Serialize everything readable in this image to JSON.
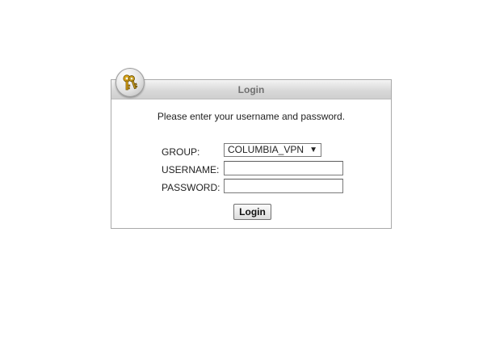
{
  "panel": {
    "title": "Login",
    "intro": "Please enter your username and password.",
    "icon": "keys-icon"
  },
  "form": {
    "group_label": "GROUP:",
    "group_value": "COLUMBIA_VPN",
    "username_label": "USERNAME:",
    "username_value": "",
    "password_label": "PASSWORD:",
    "password_value": "",
    "login_button": "Login"
  }
}
